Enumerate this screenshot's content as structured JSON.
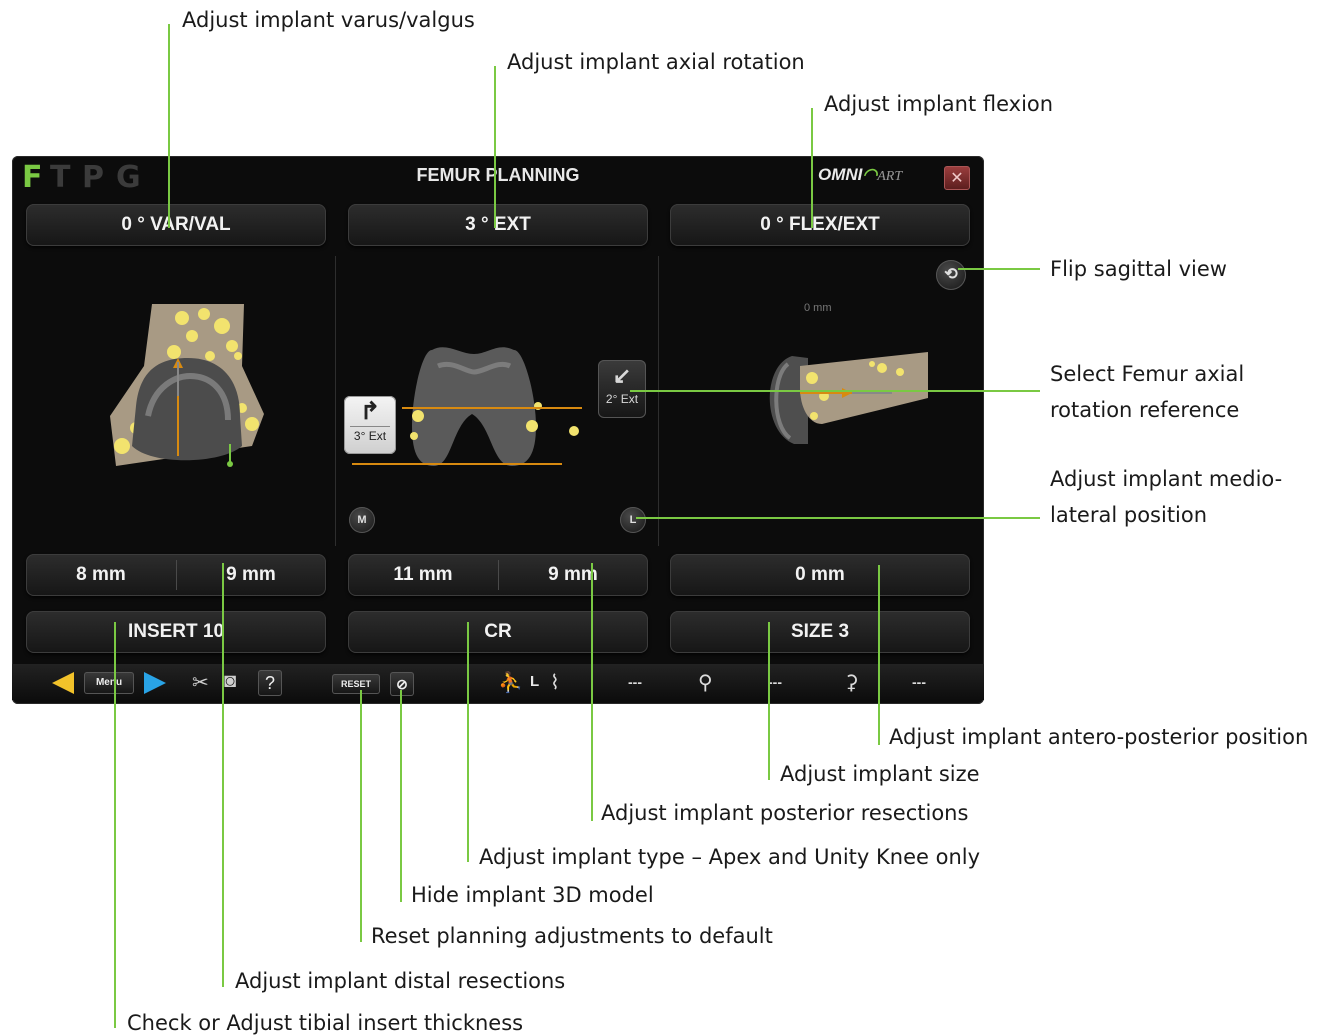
{
  "app": {
    "title": "FEMUR PLANNING",
    "tabs": [
      "F",
      "T",
      "P",
      "G"
    ],
    "active_tab": "F",
    "logo_text": "OMNI",
    "logo_suffix": "ART",
    "close_symbol": "✕"
  },
  "top_buttons": {
    "varval": "0 ° VAR/VAL",
    "rotation": "3 ° EXT",
    "flexion": "0 ° FLEX/EXT"
  },
  "center_view": {
    "left_rotation_label": "3° Ext",
    "right_rotation_label": "2° Ext",
    "medial_label": "M",
    "lateral_label": "L"
  },
  "right_view": {
    "mm_label": "0 mm",
    "flip_icon": "⟲"
  },
  "resections": {
    "distal_medial": "8 mm",
    "distal_lateral": "9 mm",
    "posterior_medial": "11 mm",
    "posterior_lateral": "9 mm",
    "ap_position": "0 mm"
  },
  "bottom_buttons": {
    "insert": "INSERT 10",
    "type": "CR",
    "size": "SIZE 3"
  },
  "toolbar": {
    "menu_label": "Menu",
    "help_label": "?",
    "reset_label": "RESET",
    "side_label": "L",
    "value1": "---",
    "value2": "---",
    "value3": "---"
  },
  "callouts": {
    "varus_valgus": "Adjust implant varus/valgus",
    "axial_rotation": "Adjust implant axial rotation",
    "flexion": "Adjust implant flexion",
    "flip_sagittal": "Flip sagittal view",
    "axial_reference_line1": "Select Femur axial",
    "axial_reference_line2": "rotation reference",
    "mediolateral_line1": "Adjust implant medio-",
    "mediolateral_line2": "lateral position",
    "antero_posterior": "Adjust implant antero-posterior position",
    "size": "Adjust implant size",
    "posterior_resections": "Adjust implant posterior resections",
    "type": "Adjust implant type – Apex and Unity Knee only",
    "hide_model": "Hide implant 3D model",
    "reset": "Reset planning adjustments to default",
    "distal_resections": "Adjust implant distal resections",
    "insert_thickness": "Check or Adjust tibial insert thickness"
  },
  "colors": {
    "callout_line": "#7ac943",
    "window_bg": "#0c0c0c",
    "accent_orange": "#e08a10",
    "bone_yellow": "#f0e070"
  }
}
